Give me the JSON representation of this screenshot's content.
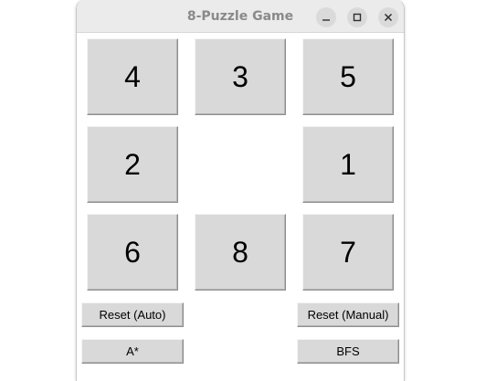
{
  "window": {
    "title": "8-Puzzle Game"
  },
  "board": {
    "tiles": [
      "4",
      "3",
      "5",
      "2",
      "1",
      "6",
      "8",
      "7"
    ],
    "empty_cell": {
      "row": 1,
      "col": 1
    }
  },
  "buttons": {
    "reset_auto": "Reset (Auto)",
    "reset_manual": "Reset (Manual)",
    "astar": "A*",
    "bfs": "BFS"
  },
  "icons": {
    "minimize": "minimize-icon",
    "maximize": "maximize-icon",
    "close": "close-icon"
  }
}
